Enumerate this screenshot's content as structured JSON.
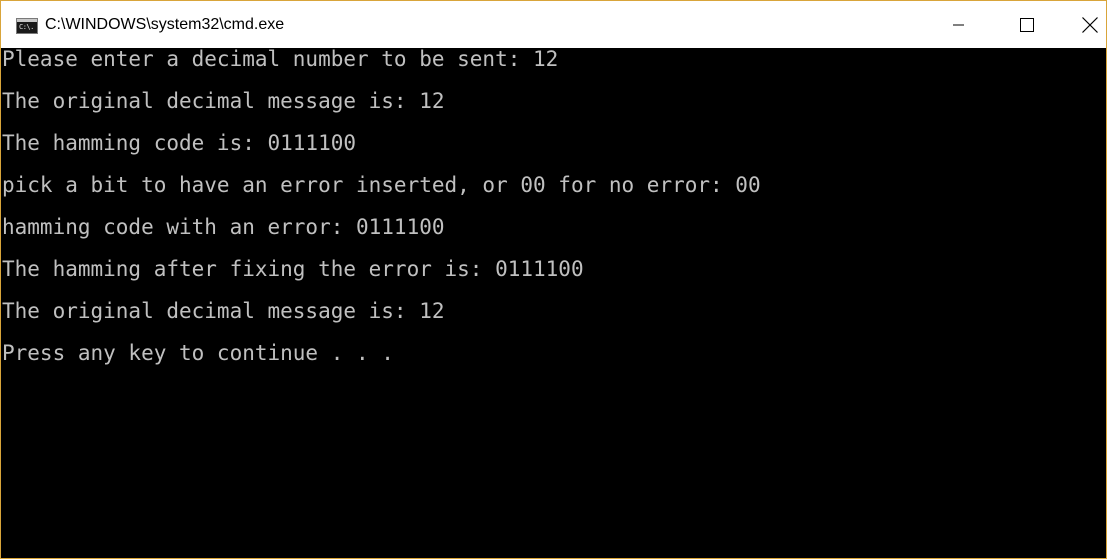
{
  "window": {
    "title": "C:\\WINDOWS\\system32\\cmd.exe",
    "icon_text": "C:\\.",
    "border_color": "#d9a53a"
  },
  "titlebar_buttons": {
    "minimize_icon": "minimize-icon",
    "maximize_icon": "maximize-icon",
    "close_icon": "close-icon"
  },
  "console": {
    "background": "#000000",
    "text_color": "#c0c0c0",
    "lines": [
      "Please enter a decimal number to be sent: 12",
      "The original decimal message is: 12",
      "The hamming code is: 0111100",
      "pick a bit to have an error inserted, or 00 for no error: 00",
      "hamming code with an error: 0111100",
      "The hamming after fixing the error is: 0111100",
      "The original decimal message is: 12",
      "Press any key to continue . . ."
    ]
  }
}
